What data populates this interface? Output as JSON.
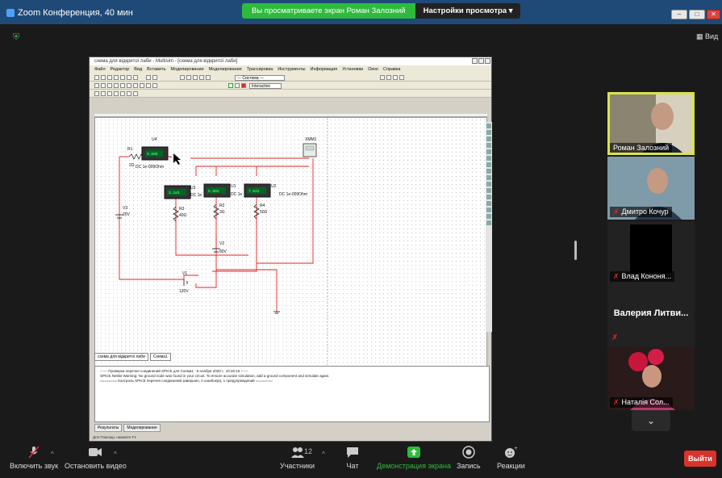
{
  "window": {
    "title": "Zoom Конференция, 40 мин",
    "banner_viewing": "Вы просматриваете экран Роман Залозний",
    "banner_options": "Настройки просмотра ▾",
    "view_label": "Вид"
  },
  "multisim": {
    "title": "схема для відкритої лаби - Multisim - [схема для відкритої лаби]",
    "menu": [
      "Файл",
      "Редактор",
      "Вид",
      "Вставить",
      "Моделирование",
      "Моделирование",
      "Трассировка",
      "Инструменты",
      "Информация",
      "Установки",
      "Окно",
      "Справка"
    ],
    "select_value": "--- Система ---",
    "interactive_label": "Interactive",
    "tabs": [
      "схема для відкритої лаби",
      "Схема1"
    ],
    "output_lines": [
      "------ Проверка перечня соединений SPICE для Схема1 - 6 ноября 2020 г., 10:26:15 ------",
      "SPICE Netlist Warning: No ground node was found in your circuit. To ensure accurate simulation, add a ground component and simulate again.",
      "======== Контроль SPICE перечня соединений завершен, 0 ошибок(и), 1 предупреждений ========"
    ],
    "bottom_tabs": [
      "Результаты",
      "Моделирование"
    ],
    "status": "Для Помощи, нажмите F1",
    "circuit": {
      "r1": "R1",
      "r1_val": "2Ω",
      "u4": "U4",
      "u4_meter": "0.000",
      "u4_dc": "DC  1e-009Ohm",
      "u3": "U3",
      "u3_meter": "3.183",
      "u3_dc": "DC  1e",
      "u1": "U1",
      "u1_meter": "5.903",
      "u1_dc": "DC  1e",
      "u2": "U2",
      "u2_meter": "7.022",
      "u2_dc": "DC  1e-009Ohm",
      "v3": "V3",
      "v3_val": "20V",
      "r3": "R3",
      "r3_val": "40Ω",
      "r2": "R2",
      "r2_val": "3Ω",
      "r4": "R4",
      "r4_val": "50Ω",
      "v2": "V2",
      "v2_val": "80V",
      "v1": "V1",
      "v1_val": "120V",
      "xmm": "XMM1"
    }
  },
  "participants": [
    {
      "name": "Роман Залозний",
      "muted": false,
      "active": true
    },
    {
      "name": "Дмитро Кочур",
      "muted": true
    },
    {
      "name": "Влад Кононя...",
      "muted": true
    },
    {
      "name": "Валерия  Литви...",
      "muted": true
    },
    {
      "name": "Наталія Сол...",
      "muted": true
    }
  ],
  "toolbar": {
    "unmute": "Включить звук",
    "start_video": "Остановить видео",
    "participants": "Участники",
    "participants_count": "12",
    "chat": "Чат",
    "share": "Демонстрация экрана",
    "record": "Запись",
    "reactions": "Реакции",
    "leave": "Выйти"
  },
  "colors": {
    "accent_green": "#2dbb3c",
    "leave_red": "#d9342b",
    "active_speaker": "#d8e34a",
    "title_bar": "#1f4a78"
  }
}
